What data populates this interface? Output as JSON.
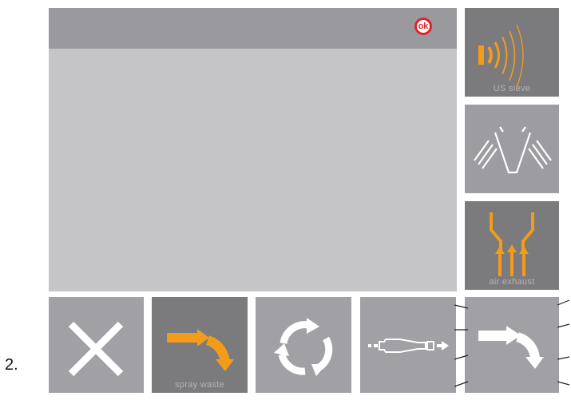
{
  "step_number": "2.",
  "status": {
    "ok_label": "ok",
    "ok_color": "#e0232b"
  },
  "sidebar": {
    "us_sieve_label": "US sieve",
    "air_exhaust_label": "air exhaust"
  },
  "bottom": {
    "spray_waste_label": "spray waste"
  },
  "colors": {
    "accent": "#f39c1a",
    "panel": "#c5c4c6",
    "button": "#a0a0a5",
    "button_dark": "#7b7a7d",
    "topbar": "#9a9a9e"
  },
  "icons": [
    "ok-badge-icon",
    "ultrasonic-sieve-icon",
    "sieve-funnel-icon",
    "air-exhaust-icon",
    "close-icon",
    "spray-waste-arrow-icon",
    "recycle-icon",
    "spray-gun-icon",
    "redirect-arrow-icon"
  ]
}
